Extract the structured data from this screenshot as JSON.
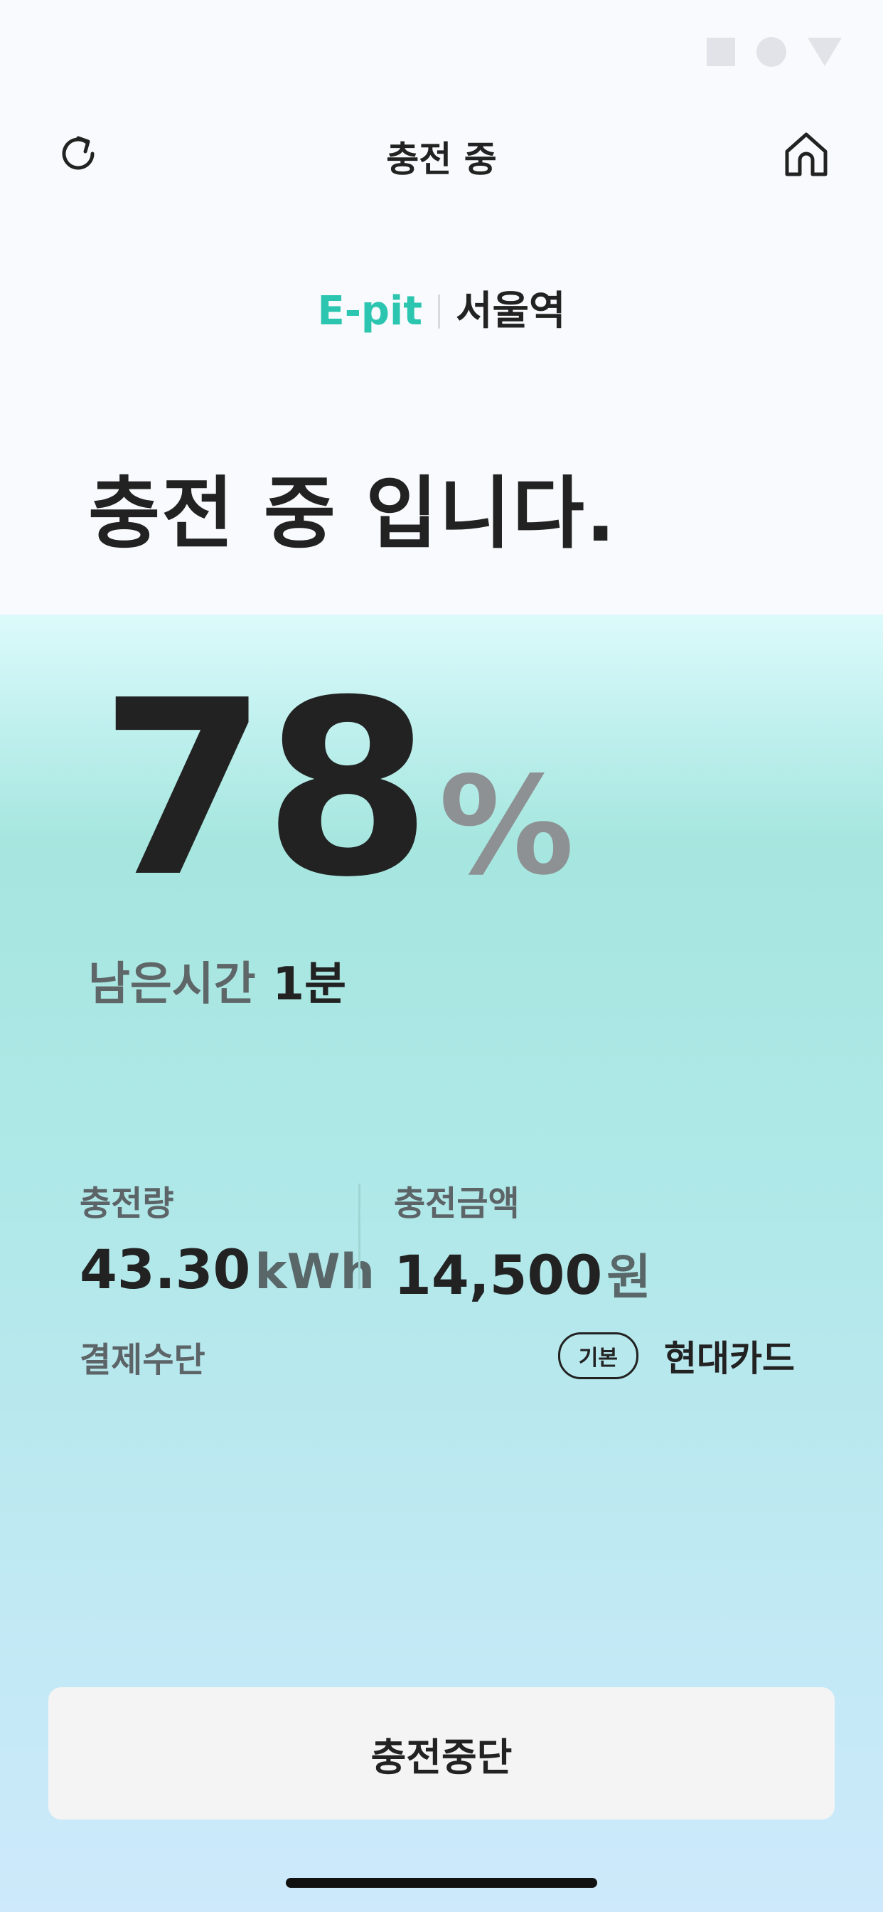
{
  "status_bar": {
    "icons": [
      "square-icon",
      "circle-icon",
      "triangle-icon"
    ]
  },
  "header": {
    "title": "충전 중",
    "left_icon": "refresh-icon",
    "right_icon": "home-icon"
  },
  "station": {
    "brand": "E-pit",
    "name": "서울역"
  },
  "headline": "충전 중 입니다.",
  "charge": {
    "percent": "78",
    "percent_unit": "%",
    "remaining_label": "남은시간",
    "remaining_value": "1분"
  },
  "stats": {
    "energy_label": "충전량",
    "energy_value": "43.30",
    "energy_unit": "kWh",
    "amount_label": "충전금액",
    "amount_value": "14,500",
    "amount_unit": "원"
  },
  "payment": {
    "label": "결제수단",
    "badge": "기본",
    "card": "현대카드"
  },
  "actions": {
    "stop_label": "충전중단"
  },
  "colors": {
    "brand": "#2cc6b0",
    "text": "#222222",
    "muted": "#8e9193"
  }
}
